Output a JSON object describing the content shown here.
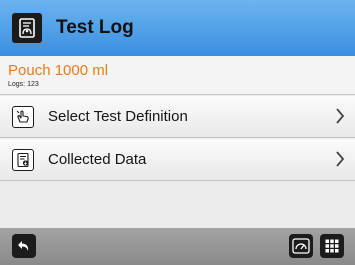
{
  "header": {
    "title": "Test Log",
    "icon": "test-log-icon"
  },
  "subheader": {
    "title": "Pouch 1000 ml",
    "logs": "Logs: 123"
  },
  "menu": {
    "items": [
      {
        "label": "Select Test Definition",
        "icon": "touch-select-icon"
      },
      {
        "label": "Collected Data",
        "icon": "collected-data-icon"
      }
    ]
  },
  "footer": {
    "back_icon": "back-icon",
    "gauge_icon": "gauge-icon",
    "grid_icon": "grid-icon"
  },
  "colors": {
    "header": "#4a9fe8",
    "accent_orange": "#f07a19",
    "footer": "#979797"
  }
}
